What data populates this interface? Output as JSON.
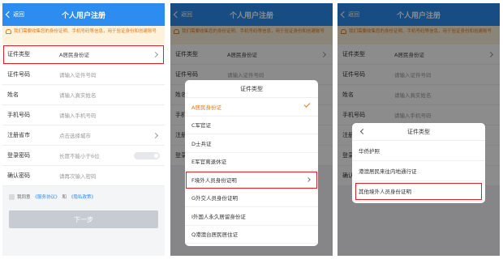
{
  "header": {
    "back_label": "返回",
    "title": "个人用户注册"
  },
  "notice": "我们需要收集您的身份证明、手机号码等信息，用于验证身份和创建账号",
  "form": {
    "rows": [
      {
        "label": "证件类型",
        "value": "A居民身份证"
      },
      {
        "label": "证件号码",
        "value": "请输入证件号码"
      },
      {
        "label": "姓名",
        "value": "请输入真实姓名"
      },
      {
        "label": "手机号码",
        "value": "请输入手机号码"
      },
      {
        "label": "注册省市",
        "value": "点击选择城市"
      },
      {
        "label": "登录密码",
        "value": "长度不能小于6位"
      },
      {
        "label": "确认密码",
        "value": "请再次输入密码"
      }
    ]
  },
  "agreement": {
    "prefix": "我同意",
    "service": "《服务协议》",
    "and": "和",
    "privacy": "《隐私政策》"
  },
  "next_button": "下一步",
  "picker1": {
    "title": "证件类型",
    "options": [
      "A居民身份证",
      "C军官证",
      "D士兵证",
      "E军官离退休证",
      "F境外人员身份证明",
      "G外交人员身份证明",
      "I外国人永久居留身份证",
      "Q港澳台居民居住证"
    ]
  },
  "picker2": {
    "title": "证件类型",
    "options": [
      "华侨护照",
      "港澳居民来往内地通行证",
      "其他境外人员身份证明"
    ]
  },
  "colors": {
    "primary": "#2d8cf0",
    "highlight": "#d9232e",
    "notice_text": "#e4781b"
  }
}
